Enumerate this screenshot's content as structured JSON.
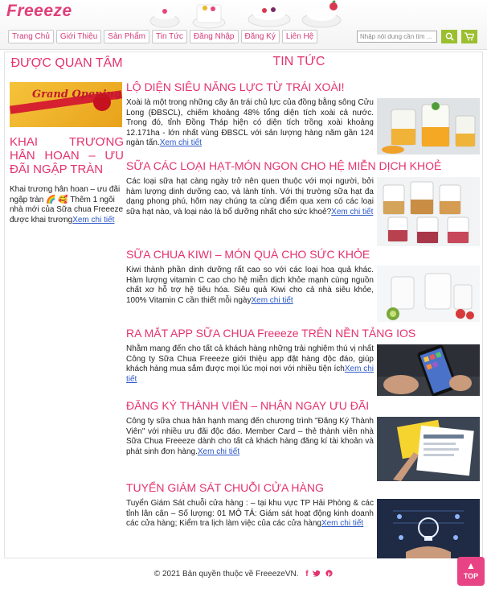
{
  "header": {
    "logo": "Freeeze",
    "nav": [
      "Trang Chủ",
      "Giới Thiệu",
      "Sản Phẩm",
      "Tin Tức",
      "Đăng Nhập",
      "Đăng Ký",
      "Liên Hệ"
    ],
    "search_placeholder": "Nhập nội dung cần tìm ...",
    "search_icon": "magnifier-icon",
    "cart_icon": "cart-icon"
  },
  "sidebar": {
    "title": "ĐƯỢC QUAN TÂM",
    "promo_text": "Grand Opening",
    "post_title": "KHAI TRƯƠNG HÂN HOAN – ƯU ĐÃI NGẬP TRÀN",
    "post_body": "Khai trương hân hoan – ưu đãi ngập tràn 🌈 🥰 Thêm 1 ngôi nhà mới của Sữa chua Freeeze được khai trương",
    "more": "Xem chi tiết"
  },
  "news": {
    "heading": "TIN TỨC",
    "more": "Xem chi tiết",
    "articles": [
      {
        "title": "LỘ DIỆN SIÊU NĂNG LỰC TỪ TRÁI XOÀI!",
        "body": "Xoài là một trong những cây ăn trái chủ lực của đồng bằng sông Cửu Long (ĐBSCL), chiếm khoảng 48% tổng diện tích xoài cả nước. Trong đó, tỉnh Đồng Tháp hiện có diện tích trồng xoài khoảng 12.171ha - lớn nhất vùng ĐBSCL với sản lượng hàng năm gần 124 ngàn tấn."
      },
      {
        "title": "SỮA CÁC LOẠI HẠT-MÓN NGON CHO HỆ MIỄN DỊCH KHOẺ",
        "body": "Các loại sữa hạt càng ngày trở nên quen thuộc với mọi người, bởi hàm lượng dinh dưỡng cao, và lành tính. Với thị trường sữa hạt đa dạng phong phú, hôm nay chúng ta cùng điểm qua xem có các loại sữa hạt nào, và loại nào là bổ dưỡng nhất cho sức khoẻ?"
      },
      {
        "title": "SỮA CHUA KIWI – MÓN QUÀ CHO SỨC KHỎE",
        "body": "Kiwi thành phần dinh dưỡng rất cao so với các loại hoa quả khác. Hàm lượng vitamin C cao cho hệ miễn dịch khỏe mạnh cùng nguồn chất xơ hỗ trợ hệ tiêu hóa. Siêu quả Kiwi cho cả nhà siêu khỏe, 100% Vitamin C cần thiết mỗi ngày"
      },
      {
        "title": "RA MẮT APP SỮA CHUA Freeeze TRÊN NỀN TẢNG IOS",
        "body": "Nhằm mang đến cho tất cả khách hàng những trải nghiệm thú vị nhất Công ty Sữa Chua Freeeze giới thiệu app đặt hàng độc đáo, giúp khách hàng mua sắm được mọi lúc mọi nơi với nhiều tiện ích"
      },
      {
        "title": "ĐĂNG KÝ THÀNH VIÊN – NHẬN NGAY ƯU ĐÃI",
        "body": "Công ty sữa chua hân hạnh mang đến chương trình \"Đăng Ký Thành Viên\" với nhiều ưu đãi độc đáo. Member Card – thẻ thành viên nhà Sữa Chua Freeeze dành cho tất cả khách hàng đăng kí tài khoản và phát sinh đơn hàng."
      },
      {
        "title": "TUYỂN GIÁM SÁT CHUỖI CỬA HÀNG",
        "body": "Tuyển Giám Sát chuỗi cửa hàng : – tại khu vực TP Hải Phòng & các tỉnh lân cận – Số lượng: 01 MÔ TẢ: Giám sát hoạt động kinh doanh các cửa hàng; Kiểm tra lịch làm việc của các cửa hàng"
      }
    ]
  },
  "footer": {
    "copyright": "© 2021 Bản quyền thuộc về FreeezeVN.",
    "social": [
      "facebook-icon",
      "twitter-icon",
      "pinterest-icon"
    ]
  },
  "top_button": {
    "label": "TOP"
  }
}
